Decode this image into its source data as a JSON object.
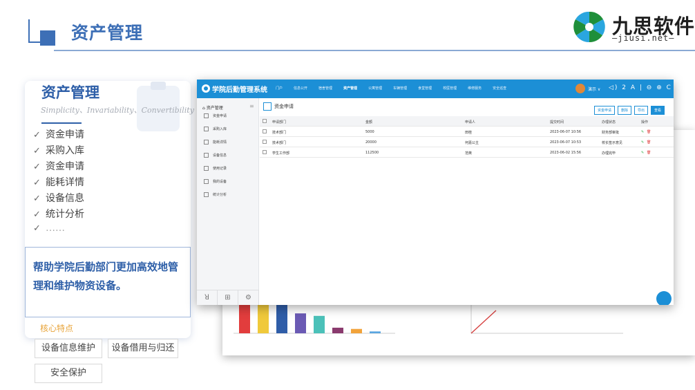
{
  "header": {
    "title": "资产管理"
  },
  "logo": {
    "name": "九思软件",
    "domain": "—jiusi.net—"
  },
  "card": {
    "title": "资产管理",
    "subtitle": "Simplicity、Invariability、Convertibility",
    "features": [
      "资金申请",
      "采购入库",
      "资金申请",
      "能耗详情",
      "设备信息",
      "统计分析",
      "……"
    ],
    "description": "帮助学院后勤部门更加高效地管理和维护物资设备。",
    "core_label": "核心特点",
    "chips": [
      "设备信息维护",
      "设备借用与归还",
      "安全保护"
    ]
  },
  "app": {
    "name": "学院后勤管理系统",
    "nav": [
      "门户",
      "信息公开",
      "宿舍管理",
      "资产管理",
      "公寓管理",
      "车辆管理",
      "食堂管理",
      "校医管理",
      "维修服务",
      "安全巡查"
    ],
    "active_nav": "资产管理",
    "user": "演示 ∨",
    "toolbar_icons": "◁) 2 A | ⊖ ⊕ C | ⏻",
    "sidebar_title": "资产管理",
    "sidebar_items": [
      "资金申请",
      "采购入库",
      "能耗详情",
      "设备信息",
      "使用记录",
      "我的设备",
      "统计分析"
    ],
    "sidebar_footer": [
      "ꓤ",
      "⊞",
      "⚙"
    ],
    "page_title": "资金申请",
    "buttons": [
      "资金申请",
      "删除",
      "导出",
      "查看"
    ],
    "columns": [
      "申请部门",
      "金额",
      "申请人",
      "提交时间",
      "办理状态",
      "操作"
    ],
    "rows": [
      {
        "dept": "技术部门",
        "amount": "5000",
        "applicant": "田桂",
        "time": "2023-06-07 10:56",
        "status": "财务部审批"
      },
      {
        "dept": "技术部门",
        "amount": "20000",
        "applicant": "何嘉公主",
        "time": "2023-06-07 10:53",
        "status": "校长签示意见"
      },
      {
        "dept": "学生工作部",
        "amount": "112500",
        "applicant": "范英",
        "time": "2023-06-02 15:56",
        "status": "办理完毕"
      }
    ],
    "action_edit": "✎",
    "action_delete": "🗑"
  },
  "chart_data": [
    {
      "type": "bar",
      "values": [
        88,
        82,
        70,
        32,
        28,
        9,
        7,
        3
      ],
      "colors": [
        "#e23d3d",
        "#f0c93b",
        "#2f5da8",
        "#6b5ab4",
        "#4bc1b9",
        "#8a3a6e",
        "#f2a33a",
        "#5aa6e0"
      ]
    },
    {
      "type": "line",
      "y": [
        0,
        6
      ],
      "ylim": [
        0,
        8
      ]
    }
  ],
  "colors": {
    "brand_blue": "#3d6fb6",
    "app_blue": "#1c8fd6",
    "accent_orange": "#e8a43a"
  }
}
